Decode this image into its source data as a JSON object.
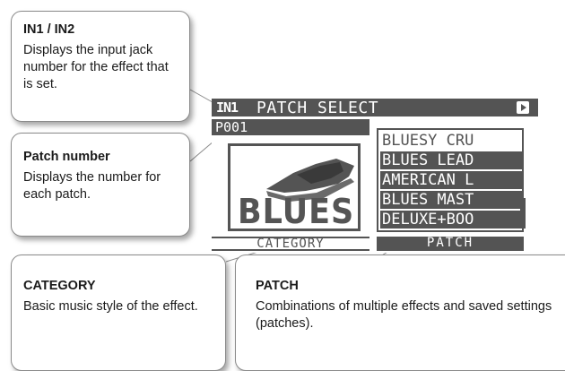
{
  "callouts": {
    "in": {
      "title": "IN1 / IN2",
      "description": "Displays the input jack number for the effect that is set."
    },
    "patch_number": {
      "title": "Patch number",
      "description": "Displays the number for each patch."
    },
    "category": {
      "title": "CATEGORY",
      "description": "Basic music style of the effect."
    },
    "patch": {
      "title": "PATCH",
      "description": "Combinations of multiple effects and saved settings (patches)."
    }
  },
  "lcd": {
    "input_indicator": "IN1",
    "title": "PATCH SELECT",
    "patch_number": "P001",
    "category_art_text": "BLUES",
    "category_label": "CATEGORY",
    "patch_tab_label": "PATCH",
    "patches": [
      "BLUESY CRU",
      "BLUES LEAD",
      "AMERICAN L",
      "BLUES MAST",
      "DELUXE+BOO"
    ],
    "selected_index": 0,
    "colors": {
      "lcd_dark": "#545454",
      "lcd_light": "#ffffff"
    }
  }
}
